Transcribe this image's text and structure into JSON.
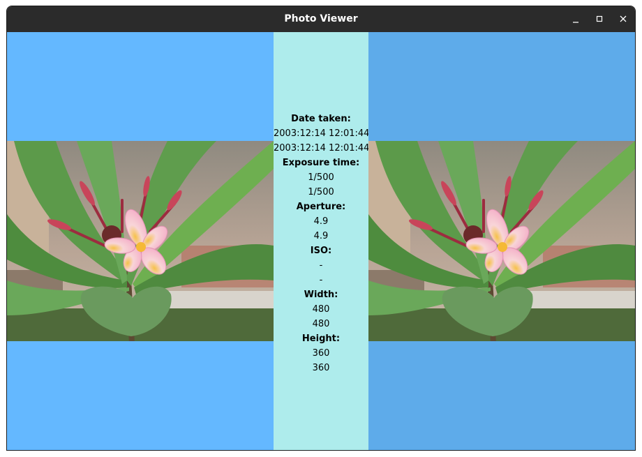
{
  "window": {
    "title": "Photo Viewer"
  },
  "metadata": [
    {
      "label": "Date taken:",
      "left": "2003:12:14 12:01:44",
      "right": "2003:12:14 12:01:44"
    },
    {
      "label": "Exposure time:",
      "left": "1/500",
      "right": "1/500"
    },
    {
      "label": "Aperture:",
      "left": "4.9",
      "right": "4.9"
    },
    {
      "label": "ISO:",
      "left": "-",
      "right": "-"
    },
    {
      "label": "Width:",
      "left": "480",
      "right": "480"
    },
    {
      "label": "Height:",
      "left": "360",
      "right": "360"
    }
  ],
  "colors": {
    "left_pane": "#64b8ff",
    "middle_pane": "#aeecec",
    "right_pane": "#5eabea",
    "titlebar": "#2b2b2b"
  },
  "icons": {
    "minimize": "minimize-icon",
    "maximize": "maximize-icon",
    "close": "close-icon"
  }
}
